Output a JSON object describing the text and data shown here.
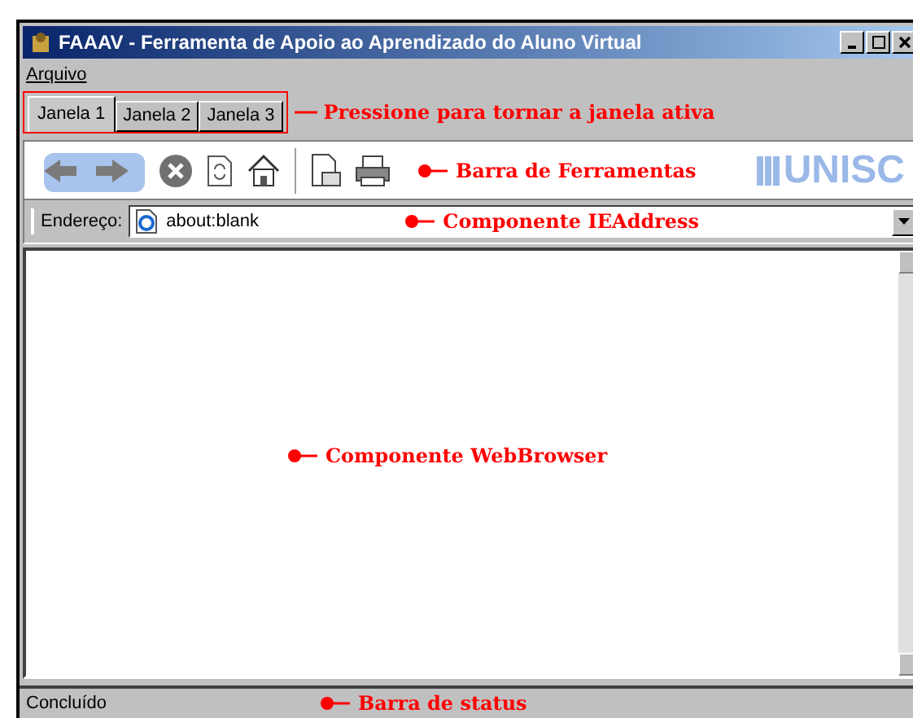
{
  "window": {
    "title": "FAAAV - Ferramenta de Apoio ao Aprendizado do Aluno Virtual"
  },
  "menu": [
    {
      "label": "Arquivo"
    }
  ],
  "tabs": [
    {
      "label": "Janela 1",
      "selected": true
    },
    {
      "label": "Janela 2",
      "selected": false
    },
    {
      "label": "Janela 3",
      "selected": false
    }
  ],
  "annotations": {
    "tabs": "Pressione para tornar a janela ativa",
    "toolbar": "Barra de Ferramentas",
    "address": "Componente IEAddress",
    "browser": "Componente WebBrowser",
    "status": "Barra de status"
  },
  "toolbar": {
    "logo": "UNISC"
  },
  "address_bar": {
    "label": "Endereço:",
    "value": "about:blank"
  },
  "status_bar": {
    "text": "Concluído"
  }
}
